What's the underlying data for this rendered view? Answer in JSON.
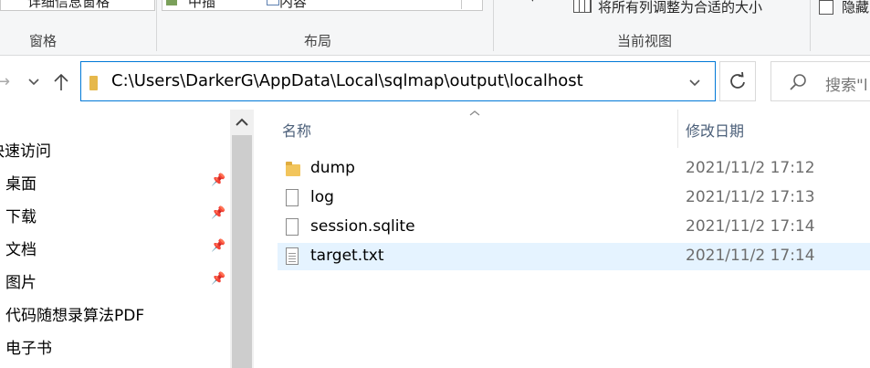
{
  "ribbon": {
    "pane_item_partial": "详细信息窗格",
    "layout_option_1": "中插",
    "layout_option_2": "内容",
    "fit_columns_label": "将所有列调整为合适的大小",
    "hide_label": "隐藏",
    "group_pane": "窗格",
    "group_layout": "布局",
    "group_current_view": "当前视图"
  },
  "address_bar": {
    "path": "C:\\Users\\DarkerG\\AppData\\Local\\sqlmap\\output\\localhost",
    "search_placeholder": "搜索\"l"
  },
  "sidebar": {
    "quick_access": "快速访问",
    "items": [
      {
        "label": "桌面",
        "pinned": true
      },
      {
        "label": "下载",
        "pinned": true
      },
      {
        "label": "文档",
        "pinned": true
      },
      {
        "label": "图片",
        "pinned": true
      },
      {
        "label": "代码随想录算法PDF",
        "pinned": false
      },
      {
        "label": "电子书",
        "pinned": false
      }
    ]
  },
  "file_list": {
    "columns": {
      "name": "名称",
      "modified": "修改日期"
    },
    "files": [
      {
        "name": "dump",
        "type": "folder",
        "modified": "2021/11/2 17:12"
      },
      {
        "name": "log",
        "type": "file",
        "modified": "2021/11/2 17:13"
      },
      {
        "name": "session.sqlite",
        "type": "file",
        "modified": "2021/11/2 17:14"
      },
      {
        "name": "target.txt",
        "type": "text-file",
        "modified": "2021/11/2 17:14",
        "selected": true
      }
    ]
  },
  "icons": {
    "back": "arrow-left-icon",
    "recent": "chevron-down-icon",
    "up": "arrow-up-icon",
    "refresh": "refresh-icon",
    "search": "search-icon",
    "pin": "pin-icon",
    "sort": "sort-ascending-icon"
  },
  "colors": {
    "accent": "#0078d7",
    "selection": "#e5f3ff",
    "header_text": "#4c607a"
  }
}
